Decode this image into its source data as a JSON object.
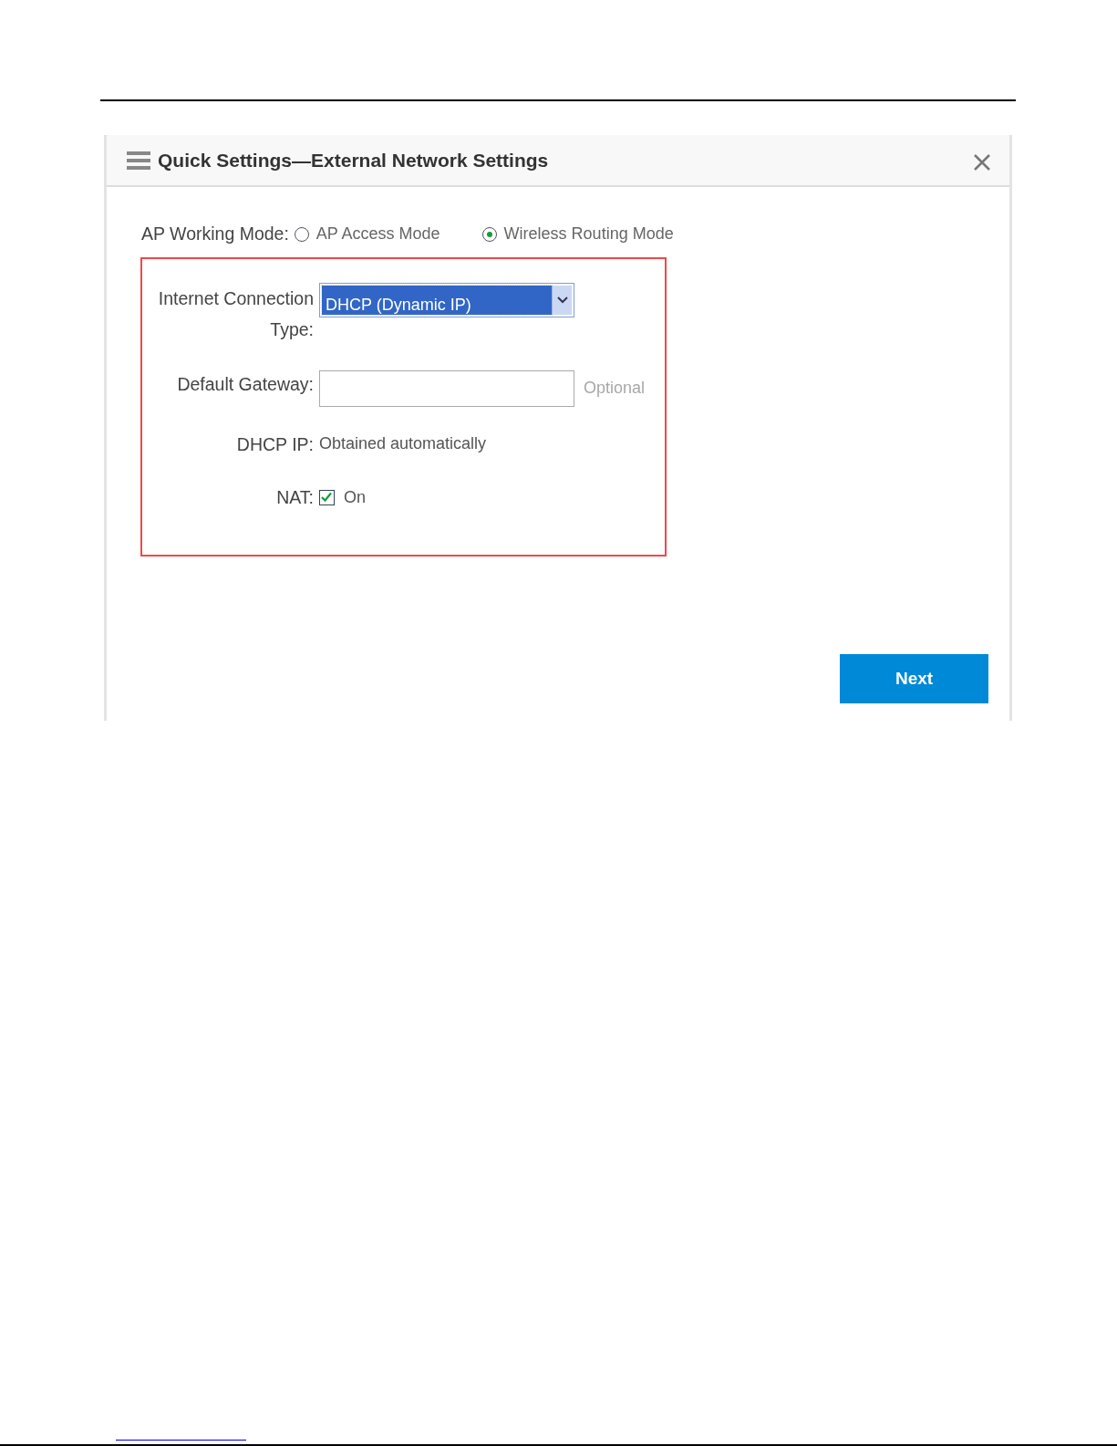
{
  "dialog": {
    "title": "Quick Settings—External Network Settings"
  },
  "mode": {
    "label": "AP Working Mode:",
    "options": [
      {
        "label": "AP Access Mode",
        "selected": false
      },
      {
        "label": "Wireless Routing Mode",
        "selected": true
      }
    ]
  },
  "fields": [
    {
      "kind": "select",
      "label": "Internet Connection Type:",
      "value": "DHCP (Dynamic IP)"
    },
    {
      "kind": "input",
      "label": "Default Gateway:",
      "hint": "Optional"
    },
    {
      "kind": "text",
      "label": "DHCP IP:",
      "value": "Obtained automatically"
    },
    {
      "kind": "checkbox",
      "label": "NAT:",
      "checked": true,
      "text": "On"
    }
  ],
  "buttons": [
    "Next"
  ]
}
